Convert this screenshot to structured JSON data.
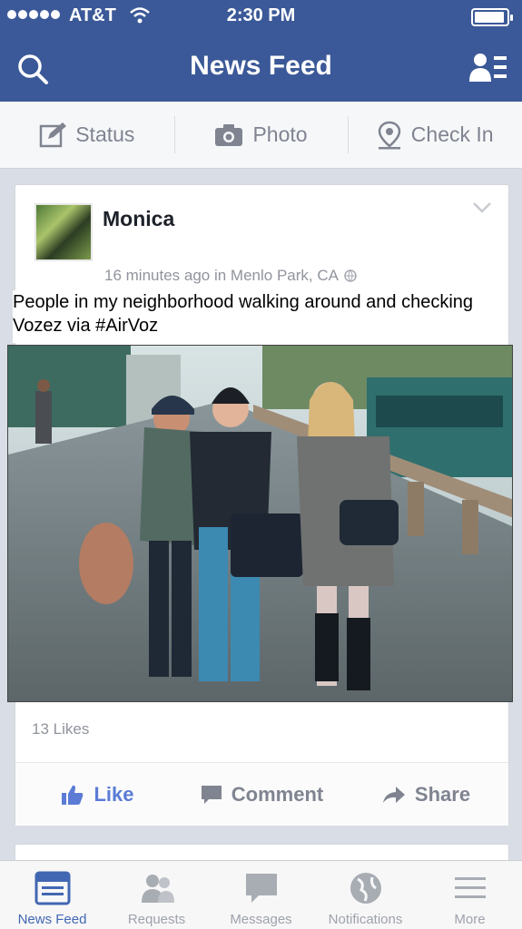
{
  "status_bar": {
    "carrier": "AT&T",
    "time": "2:30 PM"
  },
  "nav": {
    "title": "News Feed"
  },
  "composer": {
    "status_label": "Status",
    "photo_label": "Photo",
    "checkin_label": "Check In"
  },
  "post": {
    "author": "Monica",
    "meta": "16 minutes ago in Menlo Park, CA",
    "text": "People in my neighborhood walking around and checking Vozez via #AirVoz",
    "likes": "13 Likes",
    "actions": {
      "like": "Like",
      "comment": "Comment",
      "share": "Share"
    }
  },
  "tabbar": {
    "items": [
      {
        "label": "News Feed",
        "icon": "news-feed-icon"
      },
      {
        "label": "Requests",
        "icon": "friend-requests-icon"
      },
      {
        "label": "Messages",
        "icon": "messages-icon"
      },
      {
        "label": "Notifications",
        "icon": "globe-icon"
      },
      {
        "label": "More",
        "icon": "menu-icon"
      }
    ]
  },
  "colors": {
    "brand": "#3b5998",
    "active_tab": "#4267b2",
    "muted": "#90949c"
  }
}
